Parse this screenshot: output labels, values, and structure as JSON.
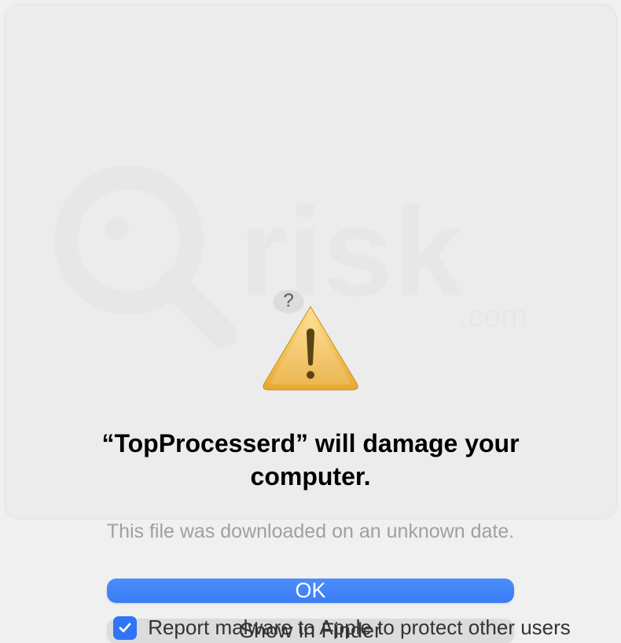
{
  "dialog": {
    "help_label": "?",
    "title": "“TopProcesserd” will damage your computer.",
    "subtitle": "This file was downloaded on an unknown date.",
    "primary_button_label": "OK",
    "secondary_button_label": "Show in Finder",
    "checkbox_label": "Report malware to Apple to protect other users",
    "checkbox_checked": true
  }
}
